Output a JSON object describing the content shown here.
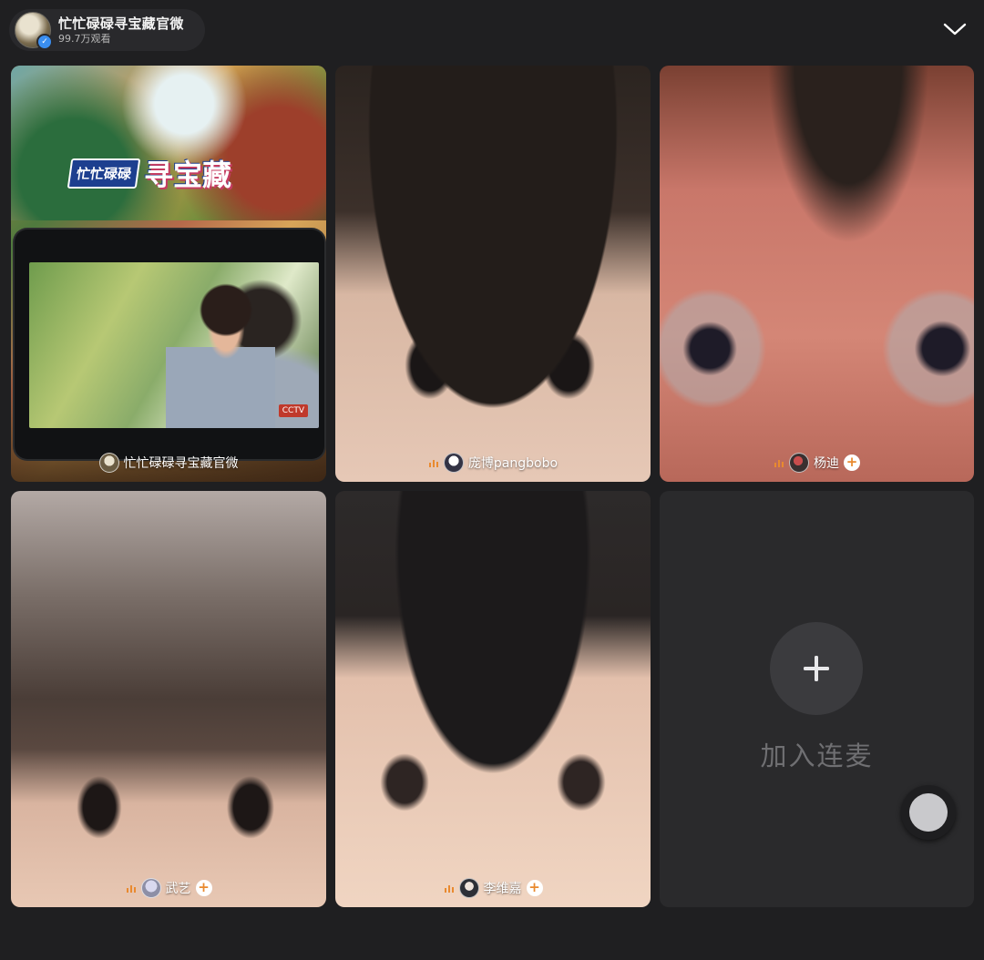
{
  "header": {
    "host_name": "忙忙碌碌寻宝藏官微",
    "viewers": "99.7万观看",
    "collapse_icon": "chevron-down-icon"
  },
  "host_tile": {
    "show_logo_chip": "忙忙碌碌",
    "show_logo_main": "寻宝藏",
    "tv_badge": "CCTV",
    "label": "忙忙碌碌寻宝藏官微"
  },
  "guests": [
    {
      "name": "庞博pangbobo",
      "follow": false
    },
    {
      "name": "杨迪",
      "follow": true
    },
    {
      "name": "武艺",
      "follow": true
    },
    {
      "name": "李维嘉",
      "follow": true
    }
  ],
  "join_slot": {
    "icon": "plus-icon",
    "label": "加入连麦"
  },
  "colors": {
    "background": "#1f1f21",
    "live_accent": "#e98a2f",
    "verified": "#3a8ef0"
  }
}
